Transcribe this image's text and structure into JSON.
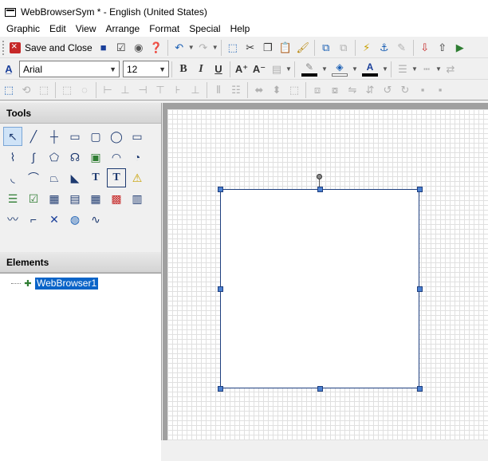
{
  "window": {
    "title": "WebBrowserSym * - English (United States)"
  },
  "menu": [
    "Graphic",
    "Edit",
    "View",
    "Arrange",
    "Format",
    "Special",
    "Help"
  ],
  "toolbar": {
    "save_close_label": "Save and Close",
    "font_name": "Arial",
    "font_size": "12",
    "bold_label": "B",
    "italic_label": "I",
    "underline_label": "U",
    "text_color_label": "A",
    "colors": {
      "line": "#000000",
      "text": "#000000",
      "accent": "#0a64c8"
    }
  },
  "left_panel": {
    "tools_title": "Tools",
    "elements_title": "Elements",
    "text_tool_label": "T",
    "text_box_tool_label": "T"
  },
  "elements": [
    {
      "label": "WebBrowser1",
      "selected": true,
      "icon": "web-browser-icon"
    }
  ]
}
